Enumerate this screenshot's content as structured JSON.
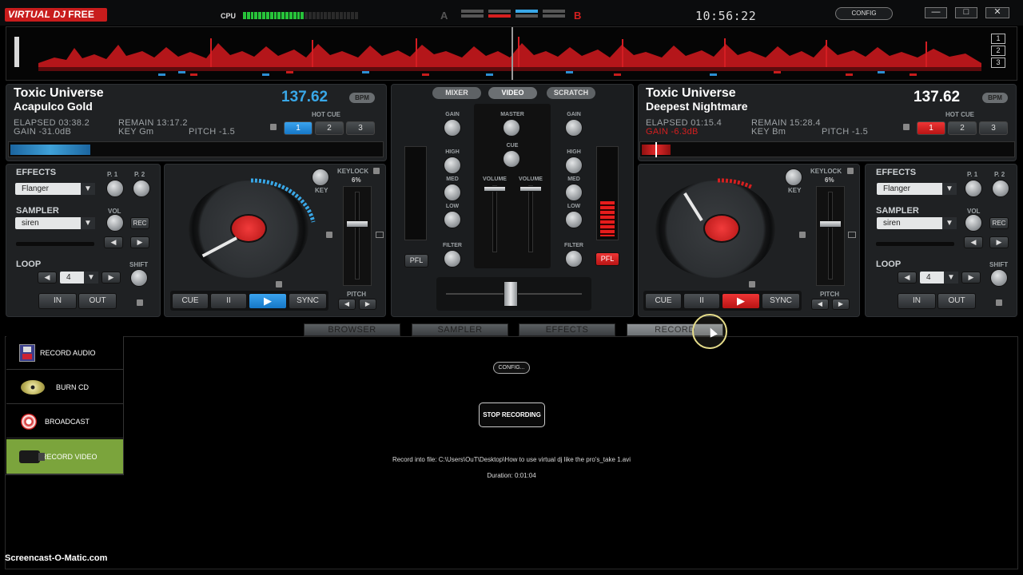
{
  "app": {
    "logo": "VIRTUAL DJ",
    "logo_suffix": "FREE",
    "cpu_label": "CPU",
    "clock": "10:56:22",
    "config_label": "CONFIG",
    "min": "—",
    "max": "□",
    "close": "✕",
    "deck_a_indicator": "A",
    "deck_b_indicator": "B"
  },
  "waveform": {
    "numbers": [
      "1",
      "2",
      "3"
    ]
  },
  "deck_a": {
    "artist": "Toxic Universe",
    "title": "Acapulco Gold",
    "bpm": "137.62",
    "bpm_button": "BPM",
    "elapsed": "ELAPSED 03:38.2",
    "remain": "REMAIN 13:17.2",
    "gain": "GAIN -31.0dB",
    "key": "KEY Gm",
    "pitch": "PITCH -1.5",
    "hot_cue_label": "HOT CUE",
    "hot_cues": [
      "1",
      "2",
      "3"
    ],
    "effects_label": "EFFECTS",
    "effect_select": "Flanger",
    "p1": "P. 1",
    "p2": "P. 2",
    "sampler_label": "SAMPLER",
    "sampler_select": "siren",
    "vol": "VOL",
    "rec": "REC",
    "loop_label": "LOOP",
    "loop_value": "4",
    "shift": "SHIFT",
    "in": "IN",
    "out": "OUT",
    "keylock_label": "KEYLOCK",
    "keylock_value": "6%",
    "key_knob": "KEY",
    "pitch_label": "PITCH",
    "transport": {
      "cue": "CUE",
      "pause": "II",
      "play": "▶",
      "sync": "SYNC"
    },
    "platter_color": "#39a8e8"
  },
  "deck_b": {
    "artist": "Toxic Universe",
    "title": "Deepest Nightmare",
    "bpm": "137.62",
    "bpm_button": "BPM",
    "elapsed": "ELAPSED 01:15.4",
    "remain": "REMAIN 15:28.4",
    "gain": "GAIN -6.3dB",
    "key": "KEY Bm",
    "pitch": "PITCH -1.5",
    "hot_cue_label": "HOT CUE",
    "hot_cues": [
      "1",
      "2",
      "3"
    ],
    "effects_label": "EFFECTS",
    "effect_select": "Flanger",
    "p1": "P. 1",
    "p2": "P. 2",
    "sampler_label": "SAMPLER",
    "sampler_select": "siren",
    "vol": "VOL",
    "rec": "REC",
    "loop_label": "LOOP",
    "loop_value": "4",
    "shift": "SHIFT",
    "in": "IN",
    "out": "OUT",
    "keylock_label": "KEYLOCK",
    "keylock_value": "6%",
    "key_knob": "KEY",
    "pitch_label": "PITCH",
    "transport": {
      "cue": "CUE",
      "pause": "II",
      "play": "▶",
      "sync": "SYNC"
    },
    "platter_color": "#d51f1f"
  },
  "mixer": {
    "tabs": [
      "MIXER",
      "VIDEO",
      "SCRATCH"
    ],
    "left": {
      "gain": "GAIN",
      "high": "HIGH",
      "med": "MED",
      "low": "LOW",
      "filter": "FILTER",
      "pfl": "PFL"
    },
    "right": {
      "gain": "GAIN",
      "high": "HIGH",
      "med": "MED",
      "low": "LOW",
      "filter": "FILTER",
      "pfl": "PFL"
    },
    "master": "MASTER",
    "cue": "CUE",
    "volume_left": "VOLUME",
    "volume_right": "VOLUME"
  },
  "bottom_tabs": [
    "BROWSER",
    "SAMPLER",
    "EFFECTS",
    "RECORD"
  ],
  "record_sidebar": [
    "RECORD AUDIO",
    "BURN CD",
    "BROADCAST",
    "RECORD VIDEO"
  ],
  "record_panel": {
    "config": "CONFIG...",
    "stop": "STOP RECORDING",
    "file": "Record into file: C:\\Users\\OuT\\Desktop\\How to use virtual dj like the pro's_take 1.avi",
    "duration": "Duration: 0:01:04"
  },
  "watermark": "Screencast-O-Matic.com"
}
